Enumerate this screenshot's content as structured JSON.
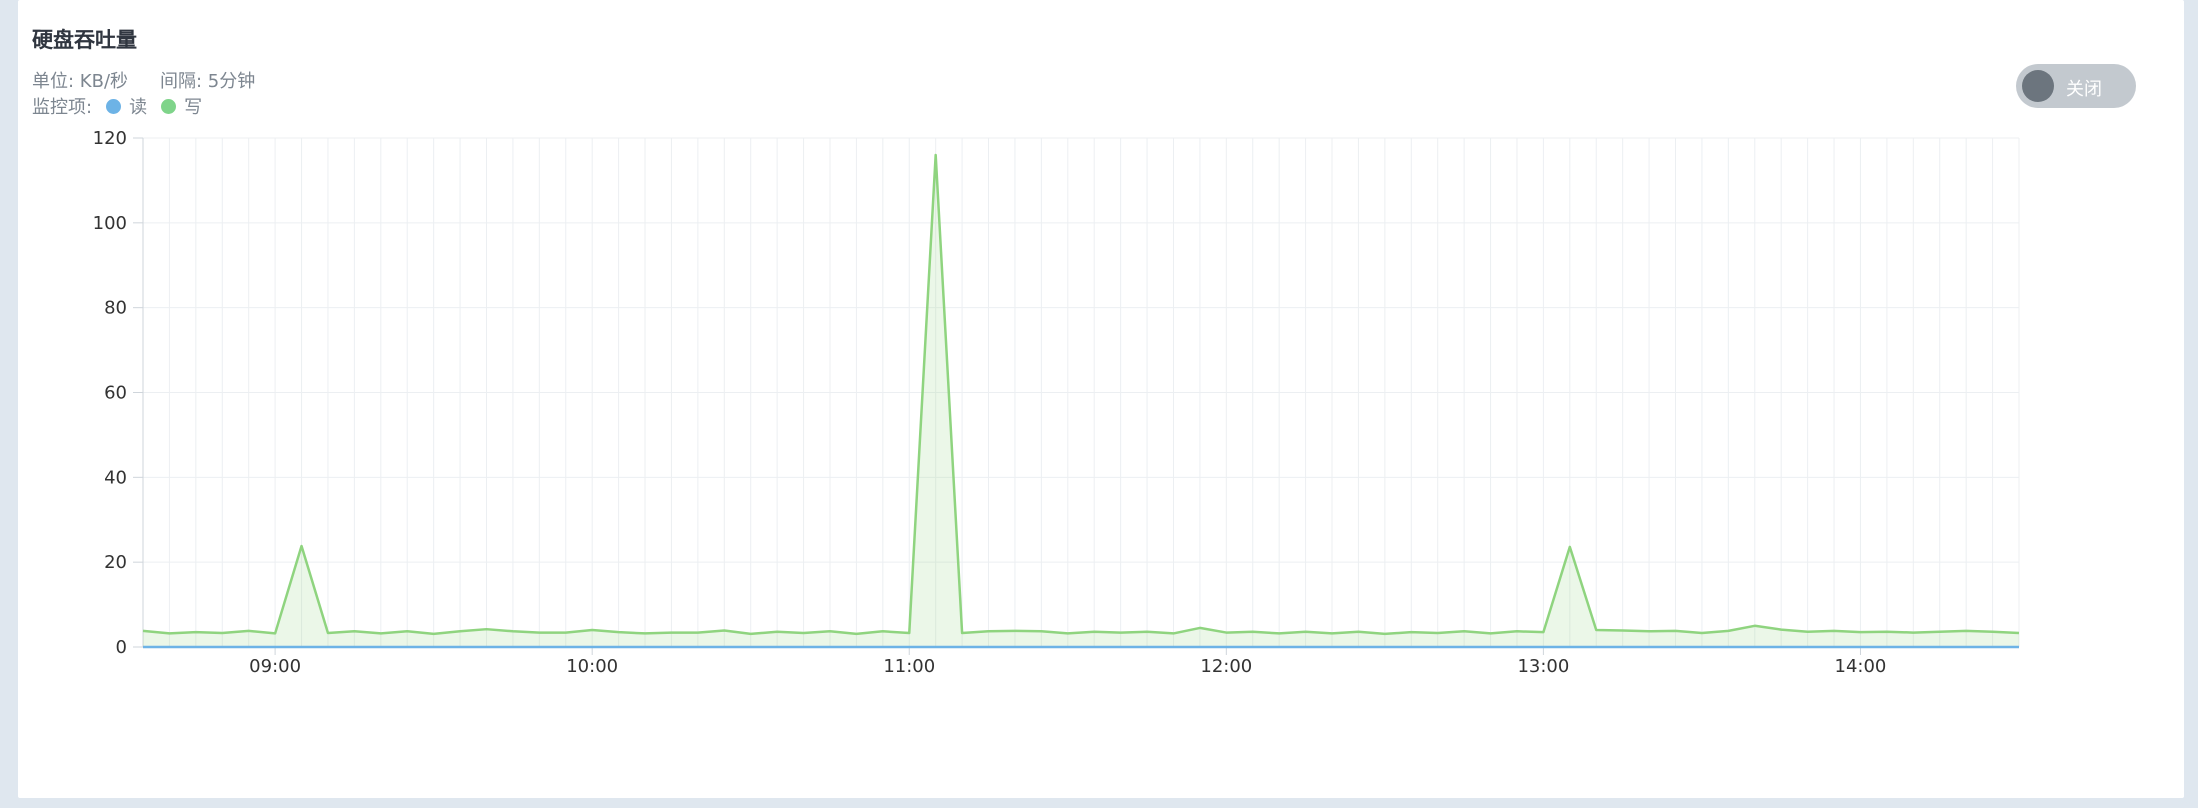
{
  "panel": {
    "title": "硬盘吞吐量",
    "unit_text": "单位: KB/秒",
    "interval_text": "间隔: 5分钟",
    "monitor_label": "监控项:",
    "legend": [
      {
        "name": "读",
        "color": "#6db3e6"
      },
      {
        "name": "写",
        "color": "#7fd48a"
      }
    ],
    "toggle_label": "关闭"
  },
  "chart_data": {
    "type": "area",
    "ylim": [
      0,
      120
    ],
    "yticks": [
      "0",
      "20",
      "40",
      "60",
      "80",
      "100",
      "120"
    ],
    "xticks": [
      "09:00",
      "10:00",
      "11:00",
      "12:00",
      "13:00",
      "14:00"
    ],
    "x": [
      "08:35",
      "08:40",
      "08:45",
      "08:50",
      "08:55",
      "09:00",
      "09:05",
      "09:10",
      "09:15",
      "09:20",
      "09:25",
      "09:30",
      "09:35",
      "09:40",
      "09:45",
      "09:50",
      "09:55",
      "10:00",
      "10:05",
      "10:10",
      "10:15",
      "10:20",
      "10:25",
      "10:30",
      "10:35",
      "10:40",
      "10:45",
      "10:50",
      "10:55",
      "11:00",
      "11:05",
      "11:10",
      "11:15",
      "11:20",
      "11:25",
      "11:30",
      "11:35",
      "11:40",
      "11:45",
      "11:50",
      "11:55",
      "12:00",
      "12:05",
      "12:10",
      "12:15",
      "12:20",
      "12:25",
      "12:30",
      "12:35",
      "12:40",
      "12:45",
      "12:50",
      "12:55",
      "13:00",
      "13:05",
      "13:10",
      "13:15",
      "13:20",
      "13:25",
      "13:30",
      "13:35",
      "13:40",
      "13:45",
      "13:50",
      "13:55",
      "14:00",
      "14:05",
      "14:10",
      "14:15",
      "14:20",
      "14:25",
      "14:30"
    ],
    "series": [
      {
        "name": "读",
        "color": "#6db3e6",
        "values": [
          0,
          0,
          0,
          0,
          0,
          0,
          0,
          0,
          0,
          0,
          0,
          0,
          0,
          0,
          0,
          0,
          0,
          0,
          0,
          0,
          0,
          0,
          0,
          0,
          0,
          0,
          0,
          0,
          0,
          0,
          0,
          0,
          0,
          0,
          0,
          0,
          0,
          0,
          0,
          0,
          0,
          0,
          0,
          0,
          0,
          0,
          0,
          0,
          0,
          0,
          0,
          0,
          0,
          0,
          0,
          0,
          0,
          0,
          0,
          0,
          0,
          0,
          0,
          0,
          0,
          0,
          0,
          0,
          0,
          0,
          0,
          0
        ]
      },
      {
        "name": "写",
        "color": "#8fd47f",
        "values": [
          3.8,
          3.2,
          3.5,
          3.3,
          3.8,
          3.2,
          23.8,
          3.3,
          3.7,
          3.2,
          3.7,
          3.1,
          3.7,
          4.2,
          3.7,
          3.4,
          3.4,
          4.0,
          3.5,
          3.2,
          3.4,
          3.4,
          3.9,
          3.1,
          3.6,
          3.3,
          3.7,
          3.1,
          3.7,
          3.3,
          116,
          3.3,
          3.7,
          3.8,
          3.7,
          3.2,
          3.6,
          3.4,
          3.6,
          3.2,
          4.5,
          3.4,
          3.6,
          3.2,
          3.6,
          3.2,
          3.6,
          3.1,
          3.5,
          3.3,
          3.7,
          3.2,
          3.7,
          3.5,
          23.6,
          4.0,
          3.9,
          3.7,
          3.8,
          3.3,
          3.8,
          5.0,
          4.1,
          3.6,
          3.8,
          3.5,
          3.6,
          3.4,
          3.6,
          3.8,
          3.6,
          3.3
        ]
      }
    ]
  }
}
